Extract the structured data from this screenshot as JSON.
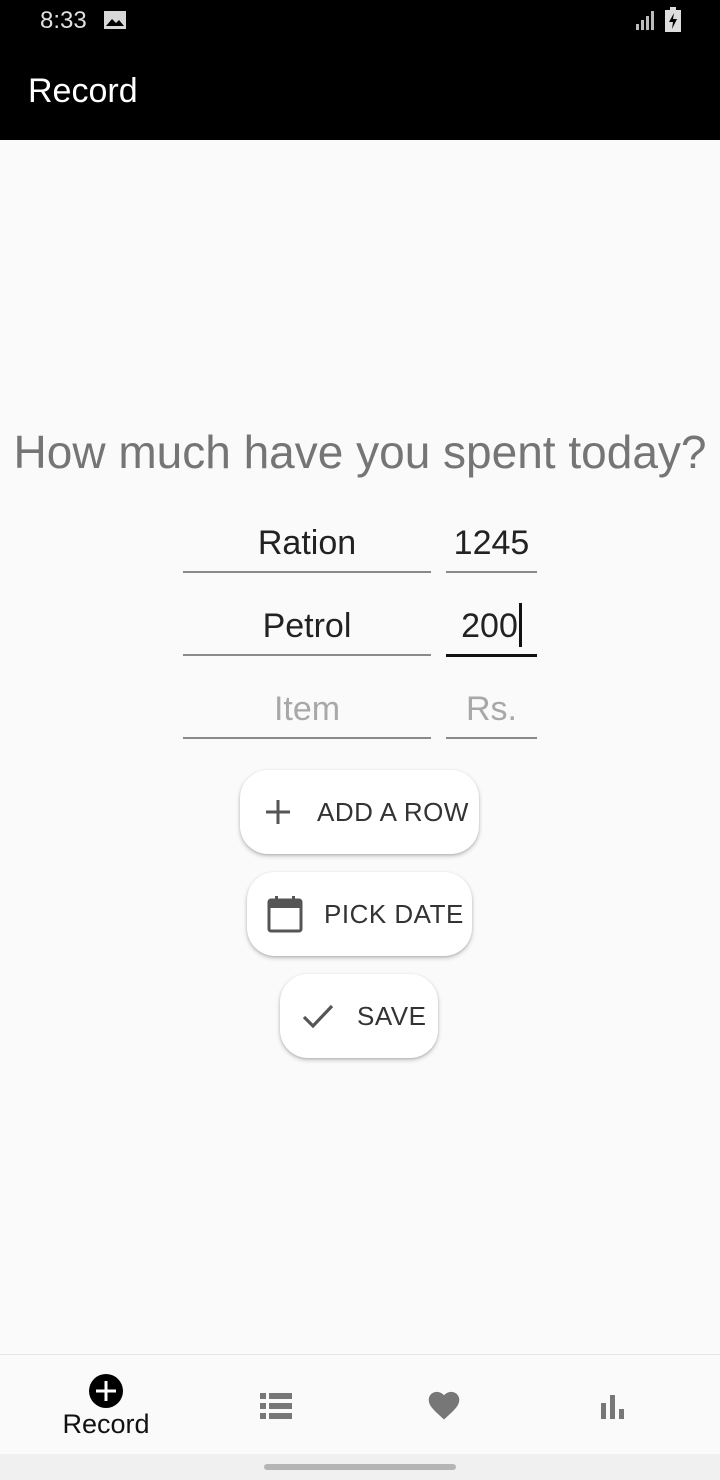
{
  "status_bar": {
    "time": "8:33"
  },
  "app_bar": {
    "title": "Record"
  },
  "question": "How much have you spent today?",
  "rows": [
    {
      "item": "Ration",
      "amount": "1245"
    },
    {
      "item": "Petrol",
      "amount": "200"
    }
  ],
  "new_row": {
    "item_placeholder": "Item",
    "amount_placeholder": "Rs."
  },
  "buttons": {
    "add_row": "ADD A ROW",
    "pick_date": "PICK DATE",
    "save": "SAVE"
  },
  "bottom_nav": {
    "active": "Record",
    "items": [
      {
        "label": "Record",
        "icon": "add-circle-icon"
      },
      {
        "label": "",
        "icon": "list-icon"
      },
      {
        "label": "",
        "icon": "heart-icon"
      },
      {
        "label": "",
        "icon": "bar-chart-icon"
      }
    ]
  },
  "colors": {
    "app_bar": "#000000",
    "background": "#fafafa",
    "question_text": "#757575"
  }
}
